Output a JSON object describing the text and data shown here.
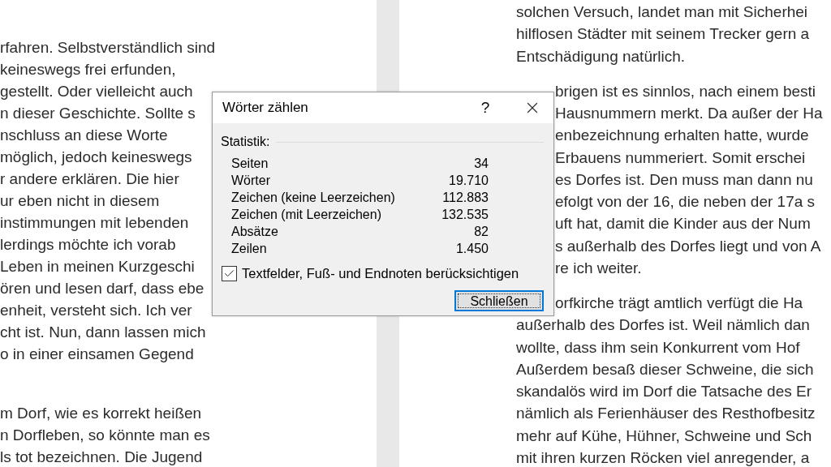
{
  "document": {
    "left_page": {
      "paragraphs": [
        [
          "rfahren. Selbstverständlich sind",
          "keineswegs frei erfunden,",
          "gestellt. Oder vielleicht auch",
          "n dieser Geschichte. Sollte s",
          "nschluss an diese Worte",
          "möglich, jedoch keineswegs",
          "r andere erklären. Die hier",
          "ur eben nicht in diesem",
          "instimmungen mit lebenden",
          "lerdings möchte ich vorab",
          "Leben in meinen Kurzgeschi",
          "ören und lesen darf, dass ebe",
          "enheit, versteht sich. Ich ver",
          "cht ist. Nun, dann lassen mich",
          "o in einer einsamen Gegend"
        ],
        [
          "m Dorf, wie es korrekt heißen",
          "n Dorfleben, so könnte man es",
          "ls tot bezeichnen. Die Jugend"
        ]
      ]
    },
    "right_page": {
      "paragraphs": [
        [
          "solchen Versuch, landet man mit Sicherhei",
          "hilflosen Städter mit seinem Trecker gern a",
          "Entschädigung natürlich."
        ],
        [
          "brigen ist es sinnlos, nach einem besti",
          "Hausnummern merkt. Da außer der Ha",
          "enbezeichnung erhalten hatte, wurde",
          "Erbauens nummeriert. Somit erschei",
          "es Dorfes ist. Den muss man dann nu",
          "efolgt von der 16, die neben der 17a s",
          "uft hat, damit die Kinder aus der Num",
          "s außerhalb des Dorfes liegt und von A",
          "re ich weiter."
        ],
        [
          "orfkirche trägt amtlich verfügt die Ha",
          "außerhalb des Dorfes ist. Weil nämlich dan",
          "wollte, dass ihm sein Konkurrent vom Hof",
          "Außerdem besaß dieser Schweine, die sich",
          "skandalös wird im Dorf die Tatsache des Er",
          "nämlich als Ferienhäuser des Resthofbesitz",
          "mehr auf Kühe, Hühner, Schweine und Sch",
          "mit ihren kurzen Röcken viel anregender, a"
        ]
      ]
    }
  },
  "dialog": {
    "title": "Wörter zählen",
    "help": "?",
    "section": "Statistik:",
    "stats": [
      {
        "label": "Seiten",
        "value": "34"
      },
      {
        "label": "Wörter",
        "value": "19.710"
      },
      {
        "label": "Zeichen (keine Leerzeichen)",
        "value": "112.883"
      },
      {
        "label": "Zeichen (mit Leerzeichen)",
        "value": "132.535"
      },
      {
        "label": "Absätze",
        "value": "82"
      },
      {
        "label": "Zeilen",
        "value": "1.450"
      }
    ],
    "checkbox": {
      "label": "Textfelder, Fuß- und Endnoten berücksichtigen",
      "checked": true
    },
    "button": "Schließen"
  }
}
